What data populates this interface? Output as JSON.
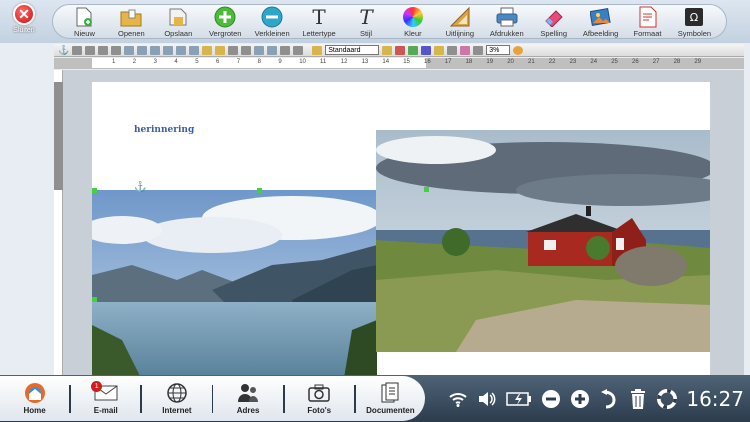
{
  "close": {
    "label": "Sluiten"
  },
  "toolbar": {
    "tools": [
      {
        "name": "new",
        "label": "Nieuw",
        "icon": "new-document-icon"
      },
      {
        "name": "open",
        "label": "Openen",
        "icon": "open-folder-icon"
      },
      {
        "name": "save",
        "label": "Opslaan",
        "icon": "save-icon"
      },
      {
        "name": "zoom-in",
        "label": "Vergroten",
        "icon": "plus-circle-icon"
      },
      {
        "name": "zoom-out",
        "label": "Verkleinen",
        "icon": "minus-circle-icon"
      },
      {
        "name": "font",
        "label": "Lettertype",
        "icon": "font-icon"
      },
      {
        "name": "style",
        "label": "Stijl",
        "icon": "italic-icon"
      },
      {
        "name": "color",
        "label": "Kleur",
        "icon": "color-wheel-icon"
      },
      {
        "name": "layout",
        "label": "Uitlijning",
        "icon": "ruler-triangle-icon"
      },
      {
        "name": "print",
        "label": "Afdrukken",
        "icon": "printer-icon"
      },
      {
        "name": "spelling",
        "label": "Spelling",
        "icon": "eraser-icon"
      },
      {
        "name": "image",
        "label": "Afbeelding",
        "icon": "image-icon"
      },
      {
        "name": "format",
        "label": "Formaat",
        "icon": "format-page-icon"
      },
      {
        "name": "symbols",
        "label": "Symbolen",
        "icon": "symbols-icon"
      }
    ]
  },
  "format_bar": {
    "style_value": "Standaard",
    "zoom_value": "3%"
  },
  "ruler": {
    "numbers": [
      "1",
      "2",
      "3",
      "4",
      "5",
      "6",
      "7",
      "8",
      "9",
      "10",
      "11",
      "12",
      "13",
      "14",
      "15",
      "16",
      "17",
      "18",
      "19",
      "20",
      "21",
      "22",
      "23",
      "24",
      "25",
      "26",
      "27",
      "28",
      "29"
    ]
  },
  "document": {
    "heading": "herinnering"
  },
  "taskbar": {
    "items": [
      {
        "name": "home",
        "label": "Home",
        "icon": "home-icon"
      },
      {
        "name": "email",
        "label": "E-mail",
        "icon": "mail-icon",
        "badge": "1"
      },
      {
        "name": "internet",
        "label": "Internet",
        "icon": "globe-icon"
      },
      {
        "name": "address",
        "label": "Adres",
        "icon": "contacts-icon"
      },
      {
        "name": "photos",
        "label": "Foto's",
        "icon": "camera-icon"
      },
      {
        "name": "documents",
        "label": "Documenten",
        "icon": "documents-icon"
      }
    ],
    "clock": "16:27"
  },
  "colors": {
    "accent": "#3a5fa8",
    "taskbar_bg": "#2c3c4d",
    "close_red": "#c90f0f"
  }
}
